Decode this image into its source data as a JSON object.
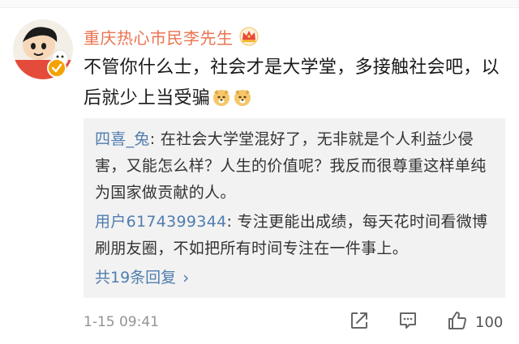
{
  "comment": {
    "username": "重庆热心市民李先生",
    "text": "不管你什么士，社会才是大学堂，多接触社会吧，以后就少上当受骗",
    "emoji_icon": "doge-emoji-icon",
    "badge_icon": "crown-icon",
    "verified_icon": "verified-badge-icon"
  },
  "replies": [
    {
      "author": "四喜_兔",
      "text": "在社会大学堂混好了，无非就是个人利益少侵害，又能怎么样？人生的价值呢？我反而很尊重这样单纯为国家做贡献的人。"
    },
    {
      "author": "用户6174399344",
      "text": "专注更能出成绩，每天花时间看微博刷朋友圈，不如把所有时间专注在一件事上。"
    }
  ],
  "more_replies_label": "共19条回复",
  "footer": {
    "timestamp": "1-15 09:41",
    "like_count": "100"
  },
  "colors": {
    "username": "#eb7350",
    "link": "#507daf",
    "reply_bg": "#f2f2f2",
    "timestamp": "#939393"
  }
}
